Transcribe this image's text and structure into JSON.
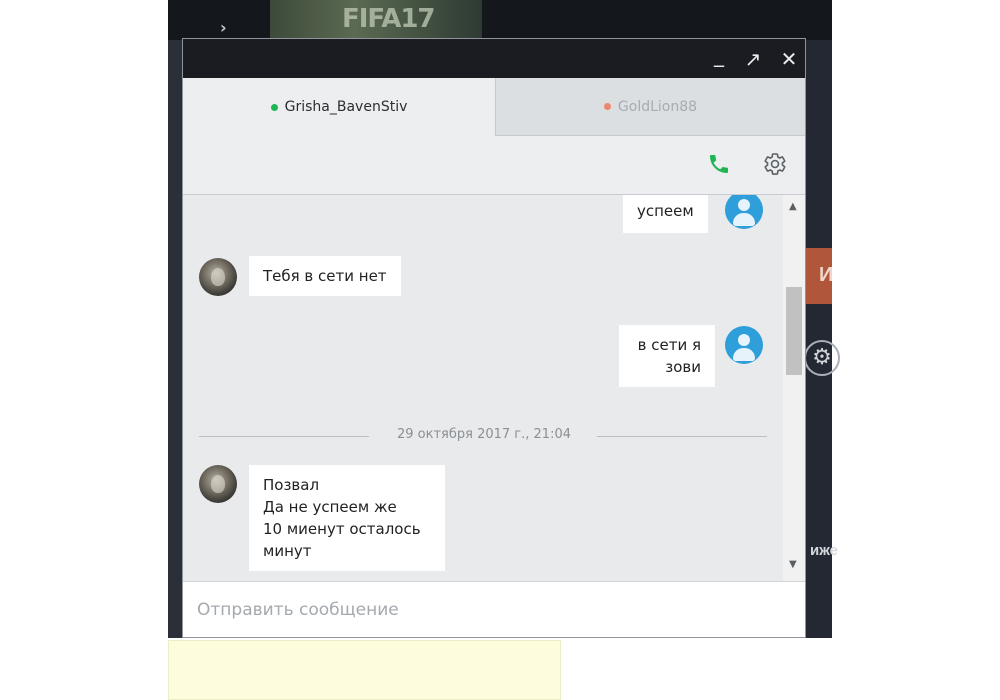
{
  "background": {
    "banner_text": "FIFA17",
    "orange_button_text": "И",
    "side_text": "иже"
  },
  "window": {
    "minimize": "_",
    "maximize": "↗",
    "close": "✕"
  },
  "tabs": [
    {
      "label": "Grisha_BavenStiv",
      "status_color": "#1fb554",
      "active": true
    },
    {
      "label": "GoldLion88",
      "status_color": "#e8896a",
      "active": false
    }
  ],
  "toolbar": {
    "call_icon": "phone-icon",
    "settings_icon": "gear-icon",
    "call_color": "#1fb554"
  },
  "messages": [
    {
      "side": "right",
      "text": "успеем"
    },
    {
      "side": "left",
      "text": "Тебя в сети нет"
    },
    {
      "side": "right",
      "lines": [
        "в сети я",
        "зови"
      ]
    },
    {
      "side": "left",
      "lines": [
        "Позвал",
        "Да не успеем же",
        "10 миенут осталось",
        "минут"
      ]
    }
  ],
  "date_separator": "29 октября 2017 г., 21:04",
  "composer": {
    "placeholder": "Отправить сообщение",
    "value": ""
  }
}
